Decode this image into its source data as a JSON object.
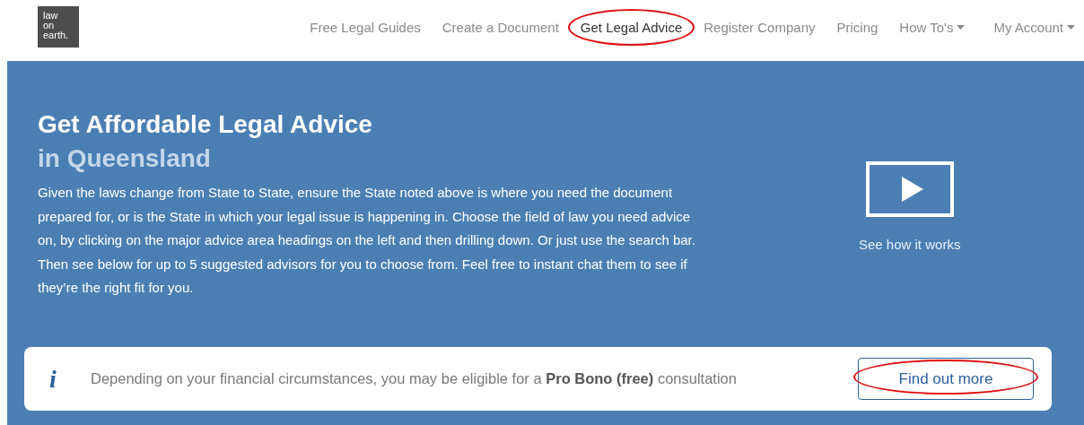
{
  "header": {
    "logo": [
      "law",
      "on",
      "earth."
    ],
    "nav": [
      {
        "label": "Free Legal Guides",
        "selected": false,
        "dropdown": false,
        "highlighted": false
      },
      {
        "label": "Create a Document",
        "selected": false,
        "dropdown": false,
        "highlighted": false
      },
      {
        "label": "Get Legal Advice",
        "selected": true,
        "dropdown": false,
        "highlighted": true
      },
      {
        "label": "Register Company",
        "selected": false,
        "dropdown": false,
        "highlighted": false
      },
      {
        "label": "Pricing",
        "selected": false,
        "dropdown": false,
        "highlighted": false
      },
      {
        "label": "How To's",
        "selected": false,
        "dropdown": true,
        "highlighted": false
      },
      {
        "label": "My Account",
        "selected": false,
        "dropdown": true,
        "highlighted": false
      }
    ]
  },
  "hero": {
    "title": "Get Affordable Legal Advice",
    "subtitle": "in Queensland",
    "description": "Given the laws change from State to State, ensure the State noted above is where you need the document prepared for, or is the State in which your legal issue is happening in. Choose the field of law you need advice on, by clicking on the major advice area headings on the left and then drilling down. Or just use the search bar. Then see below for up to 5 suggested advisors for you to choose from. Feel free to instant chat them to see if they’re the right fit for you.",
    "video_link": "See how it works"
  },
  "info_bar": {
    "icon": "i",
    "message": "Depending on your financial circumstances, you may be eligible for a **Pro Bono (free)** consultation",
    "button": {
      "label": "Find out more",
      "highlighted": true
    }
  }
}
